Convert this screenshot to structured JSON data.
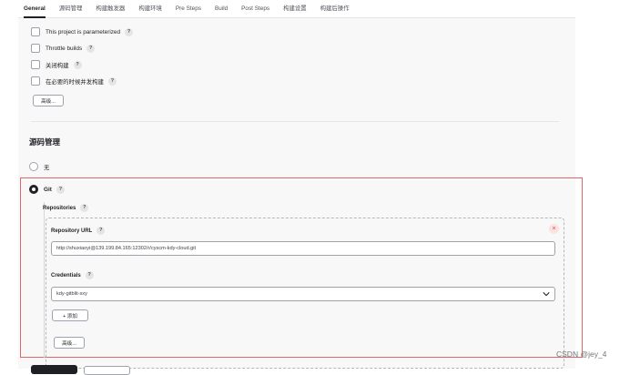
{
  "tabs": [
    "General",
    "源码管理",
    "构建触发器",
    "构建环境",
    "Pre Steps",
    "Build",
    "Post Steps",
    "构建设置",
    "构建后操作"
  ],
  "general": {
    "options": [
      {
        "label": "This project is parameterized",
        "help": "?"
      },
      {
        "label": "Throttle builds",
        "help": "?"
      },
      {
        "label": "关闭构建",
        "help": "?"
      },
      {
        "label": "在必要的时候并发构建",
        "help": "?"
      }
    ],
    "advanced_label": "高级..."
  },
  "scm": {
    "title": "源码管理",
    "none_label": "无",
    "git_label": "Git",
    "help": "?",
    "repositories_label": "Repositories",
    "repository_url_label": "Repository URL",
    "repository_url_value": "http://shuxiaoyi@139.199.84.165:12302/r/cyscm-kdy-cloud.git",
    "credentials_label": "Credentials",
    "credentials_value": "kdy-gitblit-sxy",
    "add_label": "+ 添加",
    "advanced_label": "高级...",
    "close_symbol": "×"
  },
  "watermark": "CSDN @jey_4"
}
